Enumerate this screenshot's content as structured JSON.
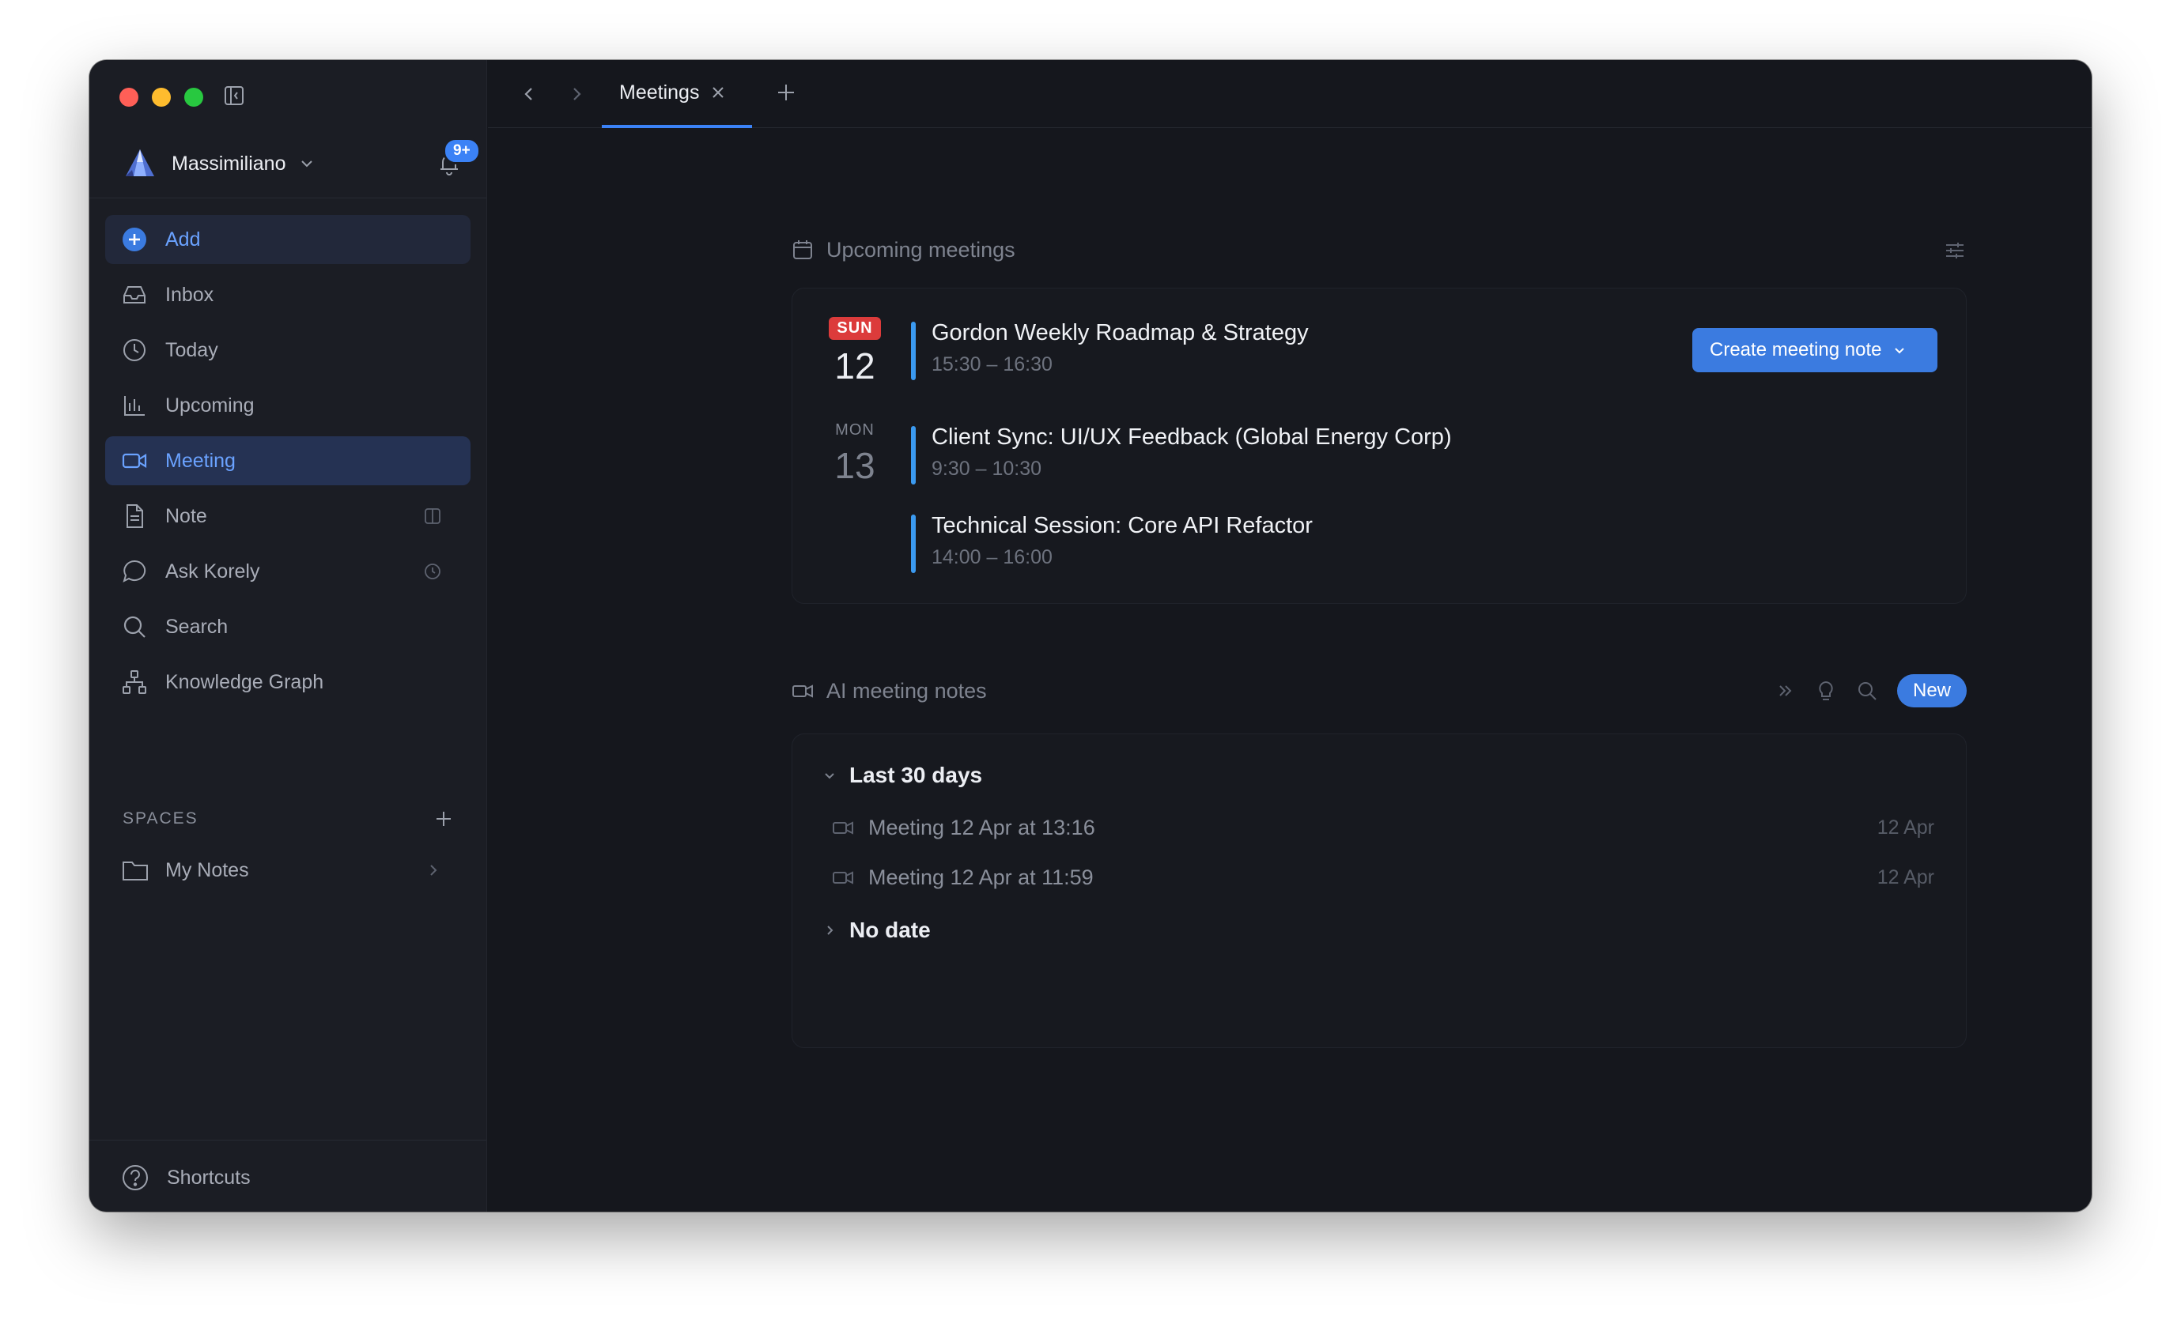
{
  "sidebar": {
    "account_name": "Massimiliano",
    "notifications_badge": "9+",
    "nav": [
      {
        "label": "Add"
      },
      {
        "label": "Inbox"
      },
      {
        "label": "Today"
      },
      {
        "label": "Upcoming"
      },
      {
        "label": "Meeting"
      },
      {
        "label": "Note"
      },
      {
        "label": "Ask Korely"
      },
      {
        "label": "Search"
      },
      {
        "label": "Knowledge Graph"
      }
    ],
    "spaces_title": "SPACES",
    "spaces": [
      {
        "label": "My Notes"
      }
    ],
    "shortcuts_label": "Shortcuts"
  },
  "tabs": [
    {
      "label": "Meetings"
    }
  ],
  "upcoming": {
    "title": "Upcoming meetings",
    "days": [
      {
        "dow": "SUN",
        "day": "12"
      },
      {
        "dow": "MON",
        "day": "13"
      }
    ],
    "events": [
      {
        "title": "Gordon Weekly Roadmap & Strategy",
        "time": "15:30 – 16:30"
      },
      {
        "title": "Client Sync: UI/UX Feedback (Global Energy Corp)",
        "time": "9:30 – 10:30"
      },
      {
        "title": "Technical Session: Core API Refactor",
        "time": "14:00 – 16:00"
      }
    ],
    "create_label": "Create meeting note"
  },
  "ai_notes": {
    "title": "AI meeting notes",
    "new_label": "New",
    "groups": [
      {
        "label": "Last 30 days",
        "items": [
          {
            "title": "Meeting 12 Apr at 13:16",
            "date": "12 Apr"
          },
          {
            "title": "Meeting 12 Apr at 11:59",
            "date": "12 Apr"
          }
        ]
      },
      {
        "label": "No date"
      }
    ]
  },
  "colors": {
    "accent": "#3b82f6",
    "window_bg": "#15171d",
    "sidebar_bg": "#1b1d24",
    "today_badge": "#dc3b3b",
    "event_bar": "#3b9af0"
  }
}
